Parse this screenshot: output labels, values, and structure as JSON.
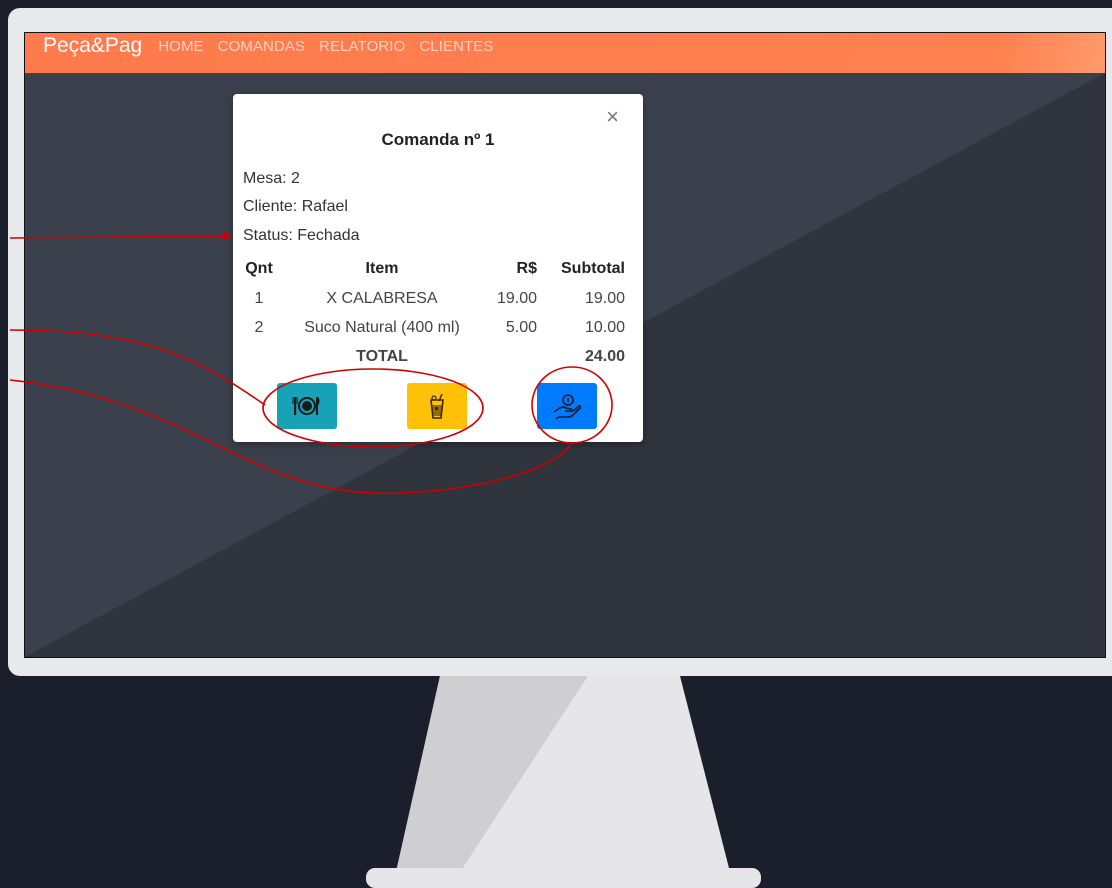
{
  "navbar": {
    "brand": "Peça&Pag",
    "links": [
      "HOME",
      "COMANDAS",
      "RELATORIO",
      "CLIENTES"
    ]
  },
  "modal": {
    "close_label": "×",
    "title": "Comanda nº 1",
    "mesa": "Mesa: 2",
    "cliente": "Cliente: Rafael",
    "status": "Status: Fechada",
    "table": {
      "headers": [
        "Qnt",
        "Item",
        "R$",
        "Subtotal"
      ],
      "rows": [
        [
          "1",
          "X CALABRESA",
          "19.00",
          "19.00"
        ],
        [
          "2",
          "Suco Natural (400 ml)",
          "5.00",
          "10.00"
        ]
      ],
      "total_label": "TOTAL",
      "total_value": "24.00"
    },
    "buttons": [
      {
        "icon": "plate-cutlery-icon",
        "color": "#17a2b8"
      },
      {
        "icon": "drink-icon",
        "color": "#ffc107"
      },
      {
        "icon": "hand-coin-payment-icon",
        "color": "#007bff"
      }
    ]
  },
  "colors": {
    "navbar": "#ff7f50",
    "screen_bg": "#343a44",
    "annotation": "#d00000"
  }
}
